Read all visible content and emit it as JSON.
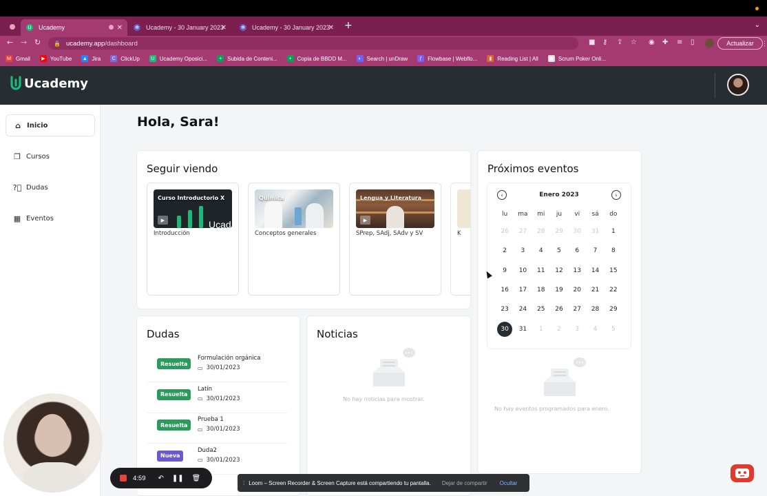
{
  "browser": {
    "tabs": [
      {
        "title": "Ucademy",
        "active": true
      },
      {
        "title": "Ucademy - 30 January 2023",
        "active": false
      },
      {
        "title": "Ucademy - 30 January 2023",
        "active": false
      }
    ],
    "new_tab": "+",
    "url_host": "ucademy.app",
    "url_path": "/dashboard",
    "update_label": "Actualizar",
    "bookmarks": [
      {
        "label": "Gmail",
        "color": "#ea4335",
        "glyph": "M"
      },
      {
        "label": "YouTube",
        "color": "#ff0000",
        "glyph": "▶"
      },
      {
        "label": "Jira",
        "color": "#2684ff",
        "glyph": "▲"
      },
      {
        "label": "ClickUp",
        "color": "#7b68ee",
        "glyph": "C"
      },
      {
        "label": "Ucademy Oposici...",
        "color": "#1db87a",
        "glyph": "U"
      },
      {
        "label": "Subida de Conteni...",
        "color": "#0f9d58",
        "glyph": "+"
      },
      {
        "label": "Copia de BBDD M...",
        "color": "#0f9d58",
        "glyph": "+"
      },
      {
        "label": "Search | unDraw",
        "color": "#6c63ff",
        "glyph": "◐"
      },
      {
        "label": "Flowbase | Webflo...",
        "color": "#7a5cff",
        "glyph": "ƒ"
      },
      {
        "label": "Reading List | All",
        "color": "#e3622e",
        "glyph": "▮"
      },
      {
        "label": "Scrum Poker Onli...",
        "color": "#dddddd",
        "glyph": "▦"
      }
    ]
  },
  "app": {
    "brand": "Ucademy",
    "brand_color": "#1db87a",
    "header_bg": "#262d33"
  },
  "sidebar": {
    "items": [
      {
        "label": "Inicio",
        "icon": "home-icon",
        "active": true
      },
      {
        "label": "Cursos",
        "icon": "courses-icon",
        "active": false
      },
      {
        "label": "Dudas",
        "icon": "question-icon",
        "active": false
      },
      {
        "label": "Eventos",
        "icon": "calendar-icon",
        "active": false
      }
    ]
  },
  "greeting": "Hola, Sara!",
  "continue_watching": {
    "title": "Seguir viendo",
    "courses": [
      {
        "thumb_title": "Curso Introductorio X",
        "subtitle": "Introducción"
      },
      {
        "thumb_title": "Química",
        "subtitle": "Conceptos generales"
      },
      {
        "thumb_title": "Lengua y Literatura",
        "subtitle": "SPrep, SAdj, SAdv y SV"
      },
      {
        "thumb_title": "",
        "subtitle": "K"
      }
    ]
  },
  "dudas": {
    "title": "Dudas",
    "items": [
      {
        "status": "Resuelta",
        "kind": "ok",
        "title": "Formulación orgánica",
        "date": "30/01/2023"
      },
      {
        "status": "Resuelta",
        "kind": "ok",
        "title": "Latín",
        "date": "30/01/2023"
      },
      {
        "status": "Resuelta",
        "kind": "ok",
        "title": "Prueba 1",
        "date": "30/01/2023"
      },
      {
        "status": "Nueva",
        "kind": "new",
        "title": "Duda2",
        "date": "30/01/2023"
      }
    ]
  },
  "noticias": {
    "title": "Noticias",
    "empty": "No hay noticias para mostrar."
  },
  "eventos": {
    "title": "Próximos eventos",
    "month": "Enero 2023",
    "weekdays": [
      "lu",
      "ma",
      "mi",
      "ju",
      "vi",
      "sá",
      "do"
    ],
    "weeks": [
      [
        {
          "d": "26",
          "m": true
        },
        {
          "d": "27",
          "m": true
        },
        {
          "d": "28",
          "m": true
        },
        {
          "d": "29",
          "m": true
        },
        {
          "d": "30",
          "m": true
        },
        {
          "d": "31",
          "m": true
        },
        {
          "d": "1"
        }
      ],
      [
        {
          "d": "2"
        },
        {
          "d": "3"
        },
        {
          "d": "4"
        },
        {
          "d": "5"
        },
        {
          "d": "6"
        },
        {
          "d": "7"
        },
        {
          "d": "8"
        }
      ],
      [
        {
          "d": "9"
        },
        {
          "d": "10"
        },
        {
          "d": "11"
        },
        {
          "d": "12"
        },
        {
          "d": "13"
        },
        {
          "d": "14"
        },
        {
          "d": "15"
        }
      ],
      [
        {
          "d": "16"
        },
        {
          "d": "17"
        },
        {
          "d": "18"
        },
        {
          "d": "19"
        },
        {
          "d": "20"
        },
        {
          "d": "21"
        },
        {
          "d": "22"
        }
      ],
      [
        {
          "d": "23"
        },
        {
          "d": "24"
        },
        {
          "d": "25"
        },
        {
          "d": "26"
        },
        {
          "d": "27"
        },
        {
          "d": "28"
        },
        {
          "d": "29"
        }
      ],
      [
        {
          "d": "30",
          "today": true
        },
        {
          "d": "31"
        },
        {
          "d": "1",
          "m": true
        },
        {
          "d": "2",
          "m": true
        },
        {
          "d": "3",
          "m": true
        },
        {
          "d": "4",
          "m": true
        },
        {
          "d": "5",
          "m": true
        }
      ]
    ],
    "empty": "No hay eventos programados para enero."
  },
  "loom": {
    "timer": "4:59",
    "share_text": "Loom – Screen Recorder & Screen Capture está compartiendo tu pantalla.",
    "stop_share": "Dejar de compartir",
    "hide": "Ocultar"
  }
}
